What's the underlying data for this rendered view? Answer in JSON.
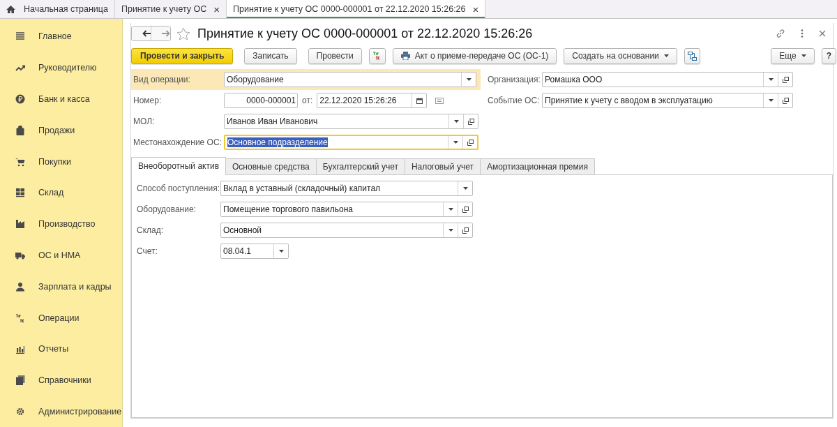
{
  "open_tabs": [
    {
      "kind": "home",
      "label": "Начальная страница",
      "selected": false
    },
    {
      "kind": "doc",
      "label": "Принятие к учету ОС",
      "close": "×",
      "selected": false
    },
    {
      "kind": "doc",
      "label": "Принятие к учету ОС 0000-000001 от 22.12.2020 15:26:26",
      "close": "×",
      "selected": true
    }
  ],
  "sidebar": {
    "items": [
      {
        "label": "Главное"
      },
      {
        "label": "Руководителю"
      },
      {
        "label": "Банк и касса"
      },
      {
        "label": "Продажи"
      },
      {
        "label": "Покупки"
      },
      {
        "label": "Склад"
      },
      {
        "label": "Производство"
      },
      {
        "label": "ОС и НМА"
      },
      {
        "label": "Зарплата и кадры"
      },
      {
        "label": "Операции"
      },
      {
        "label": "Отчеты"
      },
      {
        "label": "Справочники"
      },
      {
        "label": "Администрирование"
      }
    ]
  },
  "document": {
    "title": "Принятие к учету ОС 0000-000001 от 22.12.2020 15:26:26",
    "toolbar": [
      {
        "kind": "primary",
        "label": "Провести и закрыть"
      },
      {
        "kind": "plain",
        "label": "Записать"
      },
      {
        "kind": "plain",
        "label": "Провести"
      },
      {
        "kind": "dtkt"
      },
      {
        "kind": "print",
        "label": "Акт о приеме-передаче ОС (ОС-1)"
      },
      {
        "kind": "menu",
        "label": "Создать на основании"
      },
      {
        "kind": "structure"
      }
    ],
    "toolbar_right": [
      {
        "kind": "menu",
        "label": "Еще"
      },
      {
        "kind": "plain",
        "label": "?"
      }
    ],
    "left_fields": [
      {
        "kind": "select",
        "label": "Вид операции:",
        "value": "Оборудование",
        "highlighted": true,
        "focused": false
      },
      {
        "kind": "number",
        "label": "Номер:",
        "value": "0000-000001",
        "date_label": "от:",
        "date": "22.12.2020 15:26:26"
      },
      {
        "kind": "select-open",
        "label": "МОЛ:",
        "value": "Иванов Иван Иванович",
        "highlighted": false,
        "focused": false
      },
      {
        "kind": "select-open",
        "label": "Местонахождение ОС:",
        "value": "Основное подразделение",
        "highlighted": false,
        "focused": true
      }
    ],
    "right_fields": [
      {
        "kind": "select-open",
        "label": "Организация:",
        "value": "Ромашка ООО"
      },
      {
        "kind": "select-open",
        "label": "Событие ОС:",
        "value": "Принятие к учету с вводом в эксплуатацию"
      }
    ],
    "tabs": [
      {
        "label": "Внеоборотный актив",
        "selected": true
      },
      {
        "label": "Основные средства",
        "selected": false
      },
      {
        "label": "Бухгалтерский учет",
        "selected": false
      },
      {
        "label": "Налоговый учет",
        "selected": false
      },
      {
        "label": "Амортизационная премия",
        "selected": false
      }
    ],
    "tab_fields": [
      {
        "kind": "select",
        "label": "Способ поступления:",
        "value": "Вклад в уставный (складочный) капитал"
      },
      {
        "kind": "select-open",
        "label": "Оборудование:",
        "value": "Помещение торгового павильона"
      },
      {
        "kind": "select-open",
        "label": "Склад:",
        "value": "Основной"
      },
      {
        "kind": "short-select",
        "label": "Счет:",
        "value": "08.04.1"
      }
    ]
  }
}
